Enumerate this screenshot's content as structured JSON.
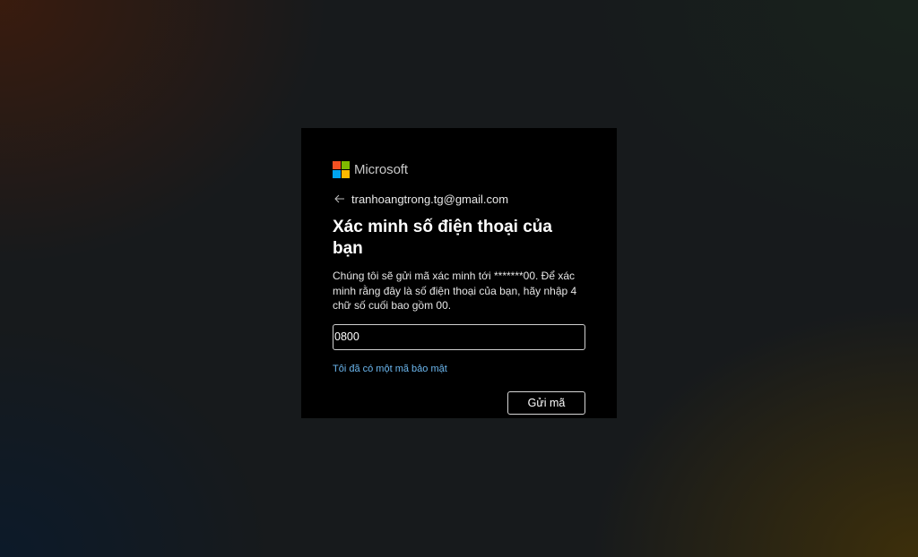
{
  "brand": {
    "name": "Microsoft",
    "logo_colors": [
      "#f25022",
      "#7fba00",
      "#00a4ef",
      "#ffb900"
    ]
  },
  "identity": {
    "back_icon": "arrow-left-icon",
    "email": "tranhoangtrong.tg@gmail.com"
  },
  "title": "Xác minh số điện thoại của bạn",
  "description": "Chúng tôi sẽ gửi mã xác minh tới *******00. Để xác minh rằng đây là số điện thoại của bạn, hãy nhập 4 chữ số cuối bao gồm 00.",
  "phone_input": {
    "value": "0800",
    "placeholder": ""
  },
  "have_code_link": "Tôi đã có một mã bảo mật",
  "send_button": "Gửi mã",
  "colors": {
    "link": "#6cb8f0",
    "card_background": "#000000"
  }
}
